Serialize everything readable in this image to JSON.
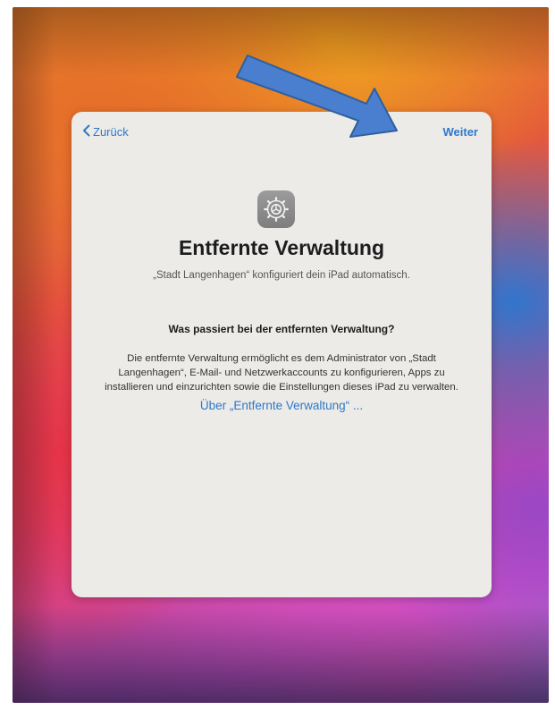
{
  "setup_screen": {
    "back_label": "Zurück",
    "next_label": "Weiter",
    "icon": "settings-gear-icon",
    "title": "Entfernte Verwaltung",
    "subtitle": "„Stadt Langenhagen“ konfiguriert dein iPad automatisch.",
    "question": "Was passiert bei der entfernten Verwaltung?",
    "body_lines": [
      "Die entfernte Verwaltung ermöglicht es dem Administrator von „Stadt",
      "Langenhagen“, E-Mail- und Netzwerkaccounts zu konfigurieren, Apps zu",
      "installieren und einzurichten sowie die Einstellungen dieses iPad zu verwalten."
    ],
    "learn_more_link": "Über „Entfernte Verwaltung“ ..."
  },
  "annotation": {
    "type": "arrow",
    "points_to": "next-button",
    "color": "#4a7fd0"
  },
  "colors": {
    "accent": "#2f78c9",
    "sheet_background": "#ecebe8",
    "title_text": "#1d1d1f"
  }
}
